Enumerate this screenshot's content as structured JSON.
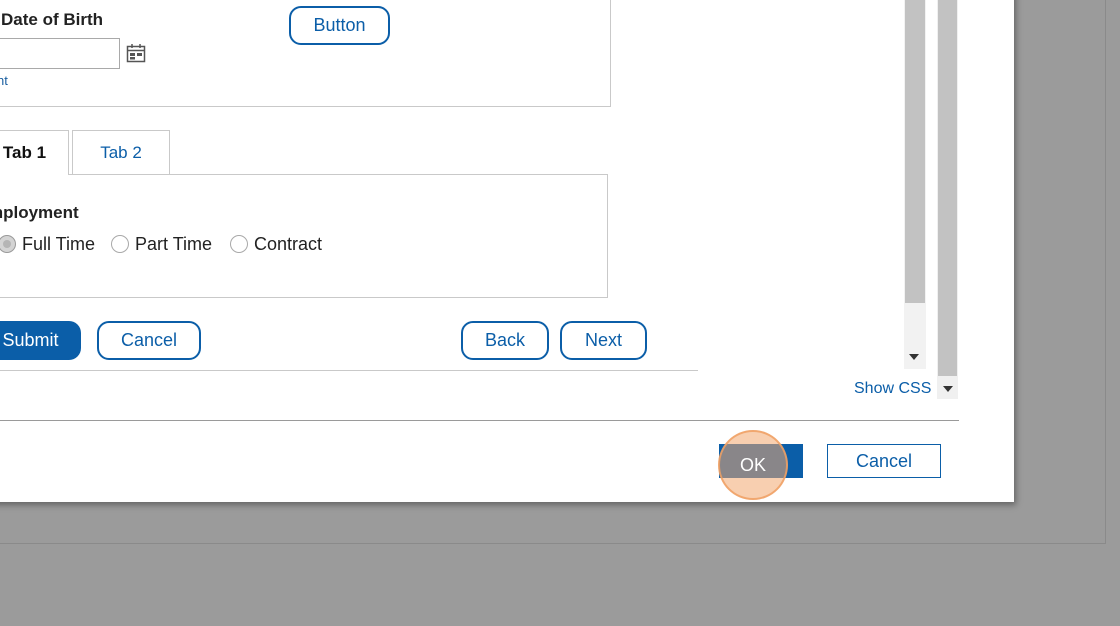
{
  "form": {
    "dob_label": "Date of Birth",
    "dob_value": "",
    "help_text": "nt",
    "button_label": "Button",
    "tabs": [
      {
        "label": "Tab 1",
        "active": true
      },
      {
        "label": "Tab 2",
        "active": false
      }
    ],
    "employment_label": "mployment",
    "radios": [
      {
        "label": "Full Time",
        "checked": true
      },
      {
        "label": "Part Time",
        "checked": false
      },
      {
        "label": "Contract",
        "checked": false
      }
    ],
    "submit_label": "Submit",
    "cancel_label": "Cancel",
    "back_label": "Back",
    "next_label": "Next"
  },
  "css_panel": {
    "show_css_label": "Show CSS"
  },
  "dialog_footer": {
    "ok_label": "OK",
    "cancel_label": "Cancel"
  },
  "colors": {
    "accent": "#0b5ea8",
    "overlay": "#9b9b9b",
    "highlight": "#f2a870"
  },
  "icons": {
    "calendar": "calendar-icon",
    "scroll_down": "chevron-down-icon"
  }
}
